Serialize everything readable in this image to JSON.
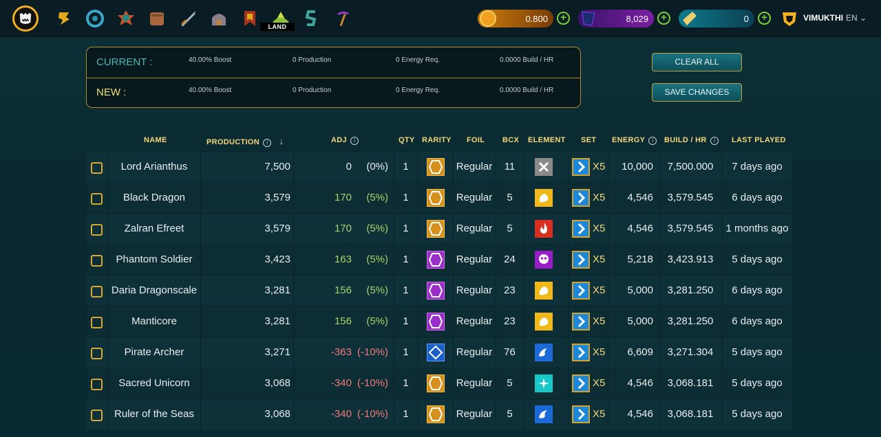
{
  "nav": {
    "icons": [
      "monster-logo-icon",
      "scroll-icon",
      "swirl-icon",
      "splinter-icon",
      "chest-icon",
      "sword-icon",
      "castle-icon",
      "banner-icon",
      "land-icon",
      "sps-icon",
      "pickaxe-icon"
    ],
    "land_label": "LAND"
  },
  "balances": {
    "dec": "0.800",
    "sps": "8,029",
    "vouchers": "0"
  },
  "user": {
    "name": "VIMUKTHI",
    "lang": "EN"
  },
  "summary": {
    "current_label": "CURRENT :",
    "new_label": "NEW :",
    "current": {
      "boost": "40.00% Boost",
      "production": "0 Production",
      "energy": "0 Energy Req.",
      "build": "0.0000 Build / HR"
    },
    "new": {
      "boost": "40.00% Boost",
      "production": "0 Production",
      "energy": "0 Energy Req.",
      "build": "0.0000 Build / HR"
    }
  },
  "buttons": {
    "clear_all": "CLEAR ALL",
    "save_changes": "SAVE CHANGES"
  },
  "table": {
    "headers": {
      "name": "NAME",
      "production": "PRODUCTION",
      "sort_arrow": "↓",
      "adj": "ADJ",
      "qty": "QTY",
      "rarity": "RARITY",
      "foil": "FOIL",
      "bcx": "BCX",
      "element": "ELEMENT",
      "set": "SET",
      "energy": "ENERGY",
      "build": "BUILD / HR",
      "last_played": "LAST PLAYED"
    },
    "rows": [
      {
        "name": "Lord Arianthus",
        "production": "7,500",
        "adj": "0",
        "adj_pct": "(0%)",
        "adj_sign": "zero",
        "qty": "1",
        "rarity": "common",
        "foil": "Regular",
        "bcx": "11",
        "element": "neutral",
        "set": "X5",
        "energy": "10,000",
        "build": "7,500.000",
        "last_played": "7 days ago"
      },
      {
        "name": "Black Dragon",
        "production": "3,579",
        "adj": "170",
        "adj_pct": "(5%)",
        "adj_sign": "pos",
        "qty": "1",
        "rarity": "common",
        "foil": "Regular",
        "bcx": "5",
        "element": "earth",
        "set": "X5",
        "energy": "4,546",
        "build": "3,579.545",
        "last_played": "6 days ago"
      },
      {
        "name": "Zalran Efreet",
        "production": "3,579",
        "adj": "170",
        "adj_pct": "(5%)",
        "adj_sign": "pos",
        "qty": "1",
        "rarity": "common",
        "foil": "Regular",
        "bcx": "5",
        "element": "fire",
        "set": "X5",
        "energy": "4,546",
        "build": "3,579.545",
        "last_played": "1 months ago"
      },
      {
        "name": "Phantom Soldier",
        "production": "3,423",
        "adj": "163",
        "adj_pct": "(5%)",
        "adj_sign": "pos",
        "qty": "1",
        "rarity": "epic",
        "foil": "Regular",
        "bcx": "24",
        "element": "death",
        "set": "X5",
        "energy": "5,218",
        "build": "3,423.913",
        "last_played": "5 days ago"
      },
      {
        "name": "Daria Dragonscale",
        "production": "3,281",
        "adj": "156",
        "adj_pct": "(5%)",
        "adj_sign": "pos",
        "qty": "1",
        "rarity": "epic",
        "foil": "Regular",
        "bcx": "23",
        "element": "earth",
        "set": "X5",
        "energy": "5,000",
        "build": "3,281.250",
        "last_played": "6 days ago"
      },
      {
        "name": "Manticore",
        "production": "3,281",
        "adj": "156",
        "adj_pct": "(5%)",
        "adj_sign": "pos",
        "qty": "1",
        "rarity": "epic",
        "foil": "Regular",
        "bcx": "23",
        "element": "earth",
        "set": "X5",
        "energy": "5,000",
        "build": "3,281.250",
        "last_played": "6 days ago"
      },
      {
        "name": "Pirate Archer",
        "production": "3,271",
        "adj": "-363",
        "adj_pct": "(-10%)",
        "adj_sign": "neg",
        "qty": "1",
        "rarity": "rare",
        "foil": "Regular",
        "bcx": "76",
        "element": "water",
        "set": "X5",
        "energy": "6,609",
        "build": "3,271.304",
        "last_played": "5 days ago"
      },
      {
        "name": "Sacred Unicorn",
        "production": "3,068",
        "adj": "-340",
        "adj_pct": "(-10%)",
        "adj_sign": "neg",
        "qty": "1",
        "rarity": "common",
        "foil": "Regular",
        "bcx": "5",
        "element": "life",
        "set": "X5",
        "energy": "4,546",
        "build": "3,068.181",
        "last_played": "5 days ago"
      },
      {
        "name": "Ruler of the Seas",
        "production": "3,068",
        "adj": "-340",
        "adj_pct": "(-10%)",
        "adj_sign": "neg",
        "qty": "1",
        "rarity": "common",
        "foil": "Regular",
        "bcx": "5",
        "element": "water",
        "set": "X5",
        "energy": "4,546",
        "build": "3,068.181",
        "last_played": "5 days ago"
      }
    ]
  },
  "colors": {
    "accent_gold": "#f3d67a",
    "border_gold": "#b08c2e",
    "adj_positive": "#a7d46a",
    "adj_negative": "#f07a7a",
    "current_label": "#4ab8b8",
    "new_label": "#f0e070"
  }
}
